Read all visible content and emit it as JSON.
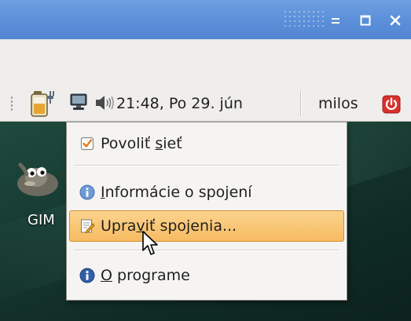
{
  "window": {
    "controls": {
      "minimize_icon": "minimize-icon",
      "maximize_icon": "maximize-icon",
      "close_icon": "close-icon"
    }
  },
  "panel": {
    "clock": "21:48, Po 29. jún",
    "user": "milos",
    "icons": [
      "battery-icon",
      "network-icon",
      "volume-icon",
      "power-icon"
    ]
  },
  "menu": {
    "items": [
      {
        "label_prefix": "Povoliť ",
        "mnemonic": "s",
        "label_suffix": "ieť",
        "icon": "checkbox-checked-icon",
        "checked": true
      },
      {
        "label_prefix": "",
        "mnemonic": "I",
        "label_suffix": "nformácie o spojení",
        "icon": "info-icon"
      },
      {
        "label_prefix": "Upra",
        "mnemonic": "v",
        "label_suffix": "iť spojenia...",
        "icon": "edit-document-icon",
        "highlighted": true
      },
      {
        "label_prefix": "",
        "mnemonic": "O",
        "label_suffix": " programe",
        "icon": "about-icon"
      }
    ]
  },
  "desktop": {
    "icons": [
      {
        "label": "GIM",
        "icon": "gimp-icon"
      }
    ]
  },
  "colors": {
    "titlebar": "#5d91da",
    "highlight": "#f7bb62",
    "highlight_border": "#cf8f2e",
    "info_blue": "#3f6fb5",
    "power_red": "#d8322d",
    "desktop": "#173a31"
  }
}
